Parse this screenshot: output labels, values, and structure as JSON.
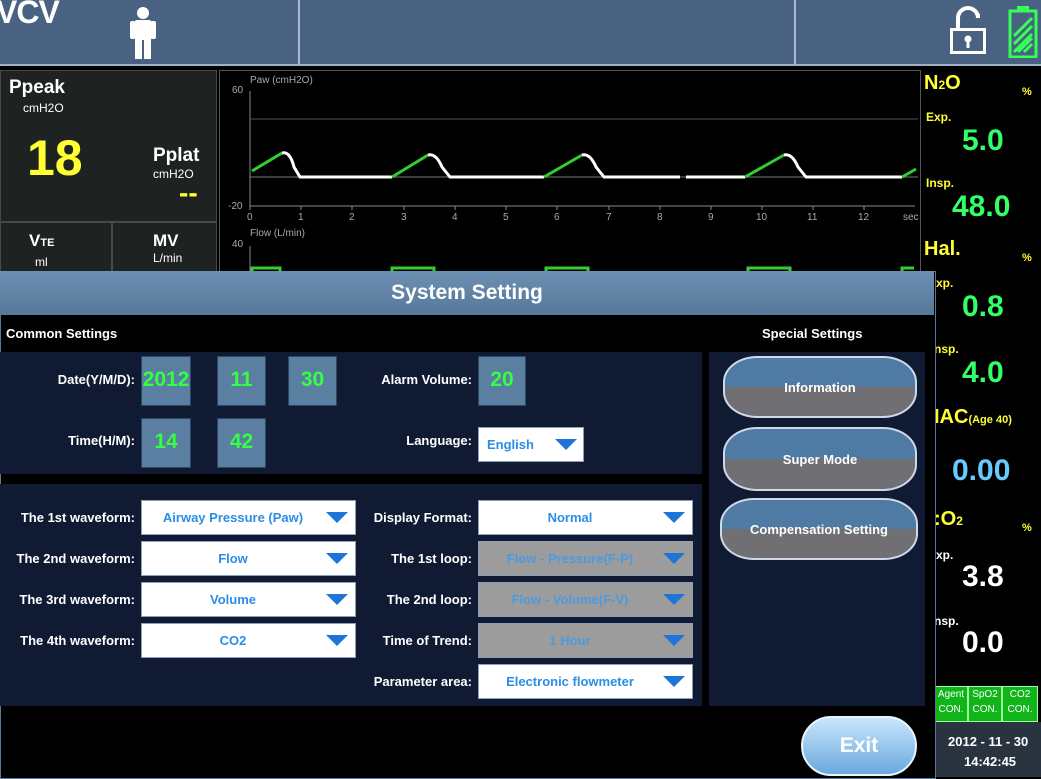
{
  "topbar": {
    "mode": "VCV"
  },
  "params": {
    "ppeak": {
      "label": "Ppeak",
      "unit": "cmH2O",
      "value": "18"
    },
    "pplat": {
      "label": "Pplat",
      "unit": "cmH2O",
      "value": "--"
    },
    "vte": {
      "label_main": "V",
      "label_sub": "TE",
      "unit": "ml"
    },
    "mv": {
      "label": "MV",
      "unit": "L/min"
    }
  },
  "waveform": {
    "paw_label": "Paw (cmH2O)",
    "paw_ymax": "60",
    "paw_ymin": "-20",
    "flow_label": "Flow (L/min)",
    "flow_ymax": "40",
    "x_ticks": [
      "0",
      "1",
      "2",
      "3",
      "4",
      "5",
      "6",
      "7",
      "8",
      "9",
      "10",
      "11",
      "12"
    ],
    "x_unit": "sec"
  },
  "gas": {
    "n2o": {
      "name": "N2O",
      "pct": "%",
      "exp_label": "Exp.",
      "exp_value": "5.0",
      "insp_label": "Insp.",
      "insp_value": "48.0"
    },
    "hal": {
      "name": "Hal.",
      "pct": "%",
      "exp_label": "xp.",
      "exp_value": "0.8",
      "insp_label": "nsp.",
      "insp_value": "4.0"
    },
    "mac": {
      "name": "IAC",
      "sub": "(Age 40)",
      "value": "0.00"
    },
    "co2": {
      "name": ":O2",
      "pct": "%",
      "exp_label": "xp.",
      "exp_value": "3.8",
      "insp_label": "nsp.",
      "insp_value": "0.0"
    },
    "status": [
      {
        "line1": "Agent",
        "line2": "CON."
      },
      {
        "line1": "SpO2",
        "line2": "CON."
      },
      {
        "line1": "CO2",
        "line2": "CON."
      }
    ],
    "date": "2012 - 11 - 30",
    "time": "14:42:45"
  },
  "dialog": {
    "title": "System Setting",
    "common_label": "Common Settings",
    "special_label": "Special Settings",
    "date_label": "Date(Y/M/D):",
    "date_year": "2012",
    "date_month": "11",
    "date_day": "30",
    "time_label": "Time(H/M):",
    "time_hour": "14",
    "time_min": "42",
    "alarm_label": "Alarm Volume:",
    "alarm_value": "20",
    "language_label": "Language:",
    "language_value": "English",
    "wave1_label": "The 1st waveform:",
    "wave1_value": "Airway Pressure (Paw)",
    "wave2_label": "The 2nd waveform:",
    "wave2_value": "Flow",
    "wave3_label": "The 3rd waveform:",
    "wave3_value": "Volume",
    "wave4_label": "The 4th waveform:",
    "wave4_value": "CO2",
    "display_label": "Display Format:",
    "display_value": "Normal",
    "loop1_label": "The 1st loop:",
    "loop1_value": "Flow - Pressure(F-P)",
    "loop2_label": "The 2nd loop:",
    "loop2_value": "Flow - Volume(F-V)",
    "trend_label": "Time of Trend:",
    "trend_value": "1 Hour",
    "param_label": "Parameter area:",
    "param_value": "Electronic flowmeter",
    "btn_information": "Information",
    "btn_super": "Super Mode",
    "btn_compensation": "Compensation Setting",
    "exit": "Exit"
  }
}
